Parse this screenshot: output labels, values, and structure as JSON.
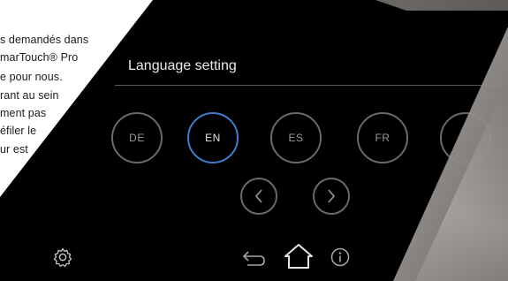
{
  "brochure_text": [
    "s demandés dans",
    "marTouch® Pro",
    "e  pour  nous.",
    "rant au sein",
    "ment pas",
    "éfiler le",
    "ur est"
  ],
  "screen": {
    "title": "Language setting",
    "languages": [
      {
        "code": "DE",
        "selected": false
      },
      {
        "code": "EN",
        "selected": true
      },
      {
        "code": "ES",
        "selected": false
      },
      {
        "code": "FR",
        "selected": false
      }
    ],
    "accent_color": "#3f7ecf",
    "icons": {
      "prev": "chevron-left-icon",
      "next": "chevron-right-icon",
      "settings": "gear-icon",
      "back": "back-arrow-icon",
      "home": "home-icon",
      "info": "info-icon"
    }
  }
}
